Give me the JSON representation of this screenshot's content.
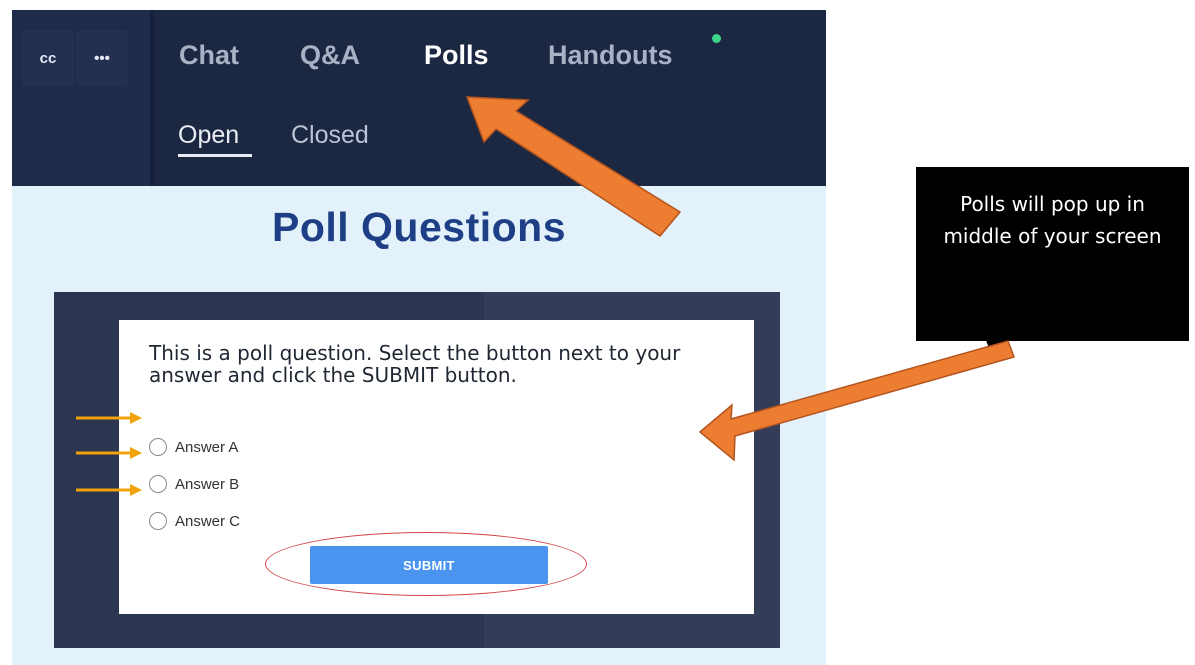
{
  "toolbar": {
    "cc_label": "cc",
    "more_label": "•••"
  },
  "tabs": [
    {
      "label": "Chat",
      "active": false
    },
    {
      "label": "Q&A",
      "active": false
    },
    {
      "label": "Polls",
      "active": true
    },
    {
      "label": "Handouts",
      "active": false
    }
  ],
  "subtabs": [
    {
      "label": "Open",
      "active": true
    },
    {
      "label": "Closed",
      "active": false
    }
  ],
  "poll": {
    "heading": "Poll Questions",
    "question": "This is a poll question. Select the button next to your answer and click the SUBMIT button.",
    "answers": [
      "Answer A",
      "Answer B",
      "Answer C"
    ],
    "submit_label": "SUBMIT"
  },
  "callout": {
    "text": "Polls will pop up in middle of your screen"
  },
  "colors": {
    "nav_bg": "#1c2742",
    "poll_bg": "#e3f1fb",
    "heading": "#1e3f85",
    "submit": "#4a94f0",
    "arrow_orange": "#ed7d31",
    "arrow_yellow": "#f0a30a",
    "ellipse_red": "#d24747",
    "notify_dot": "#3dd68c"
  }
}
